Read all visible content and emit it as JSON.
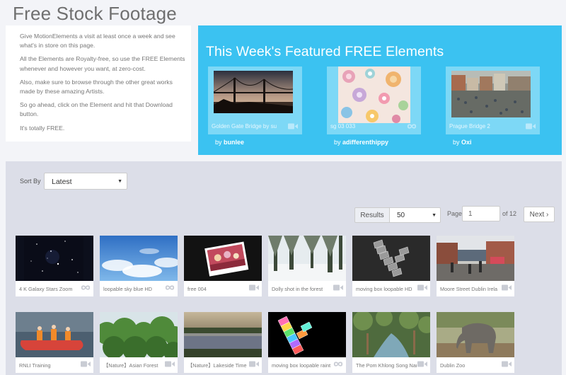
{
  "page_title": "Free Stock Footage",
  "intro": {
    "paragraphs": [
      "Give MotionElements a visit at least once a week and see what's in store on this page.",
      "All the Elements are Royalty-free, so use the FREE Elements whenever and however you want, at zero-cost.",
      "Also, make sure to browse through the other great works made by these amazing Artists.",
      "So go ahead, click on the Element and hit that Download button.",
      "It's totally FREE."
    ]
  },
  "featured": {
    "heading": "This Week's Featured FREE Elements",
    "items": [
      {
        "caption": "Golden Gate Bridge by su",
        "by": "by",
        "author": "bunlee",
        "icon": "video-camera-icon"
      },
      {
        "caption": "sg 03 033",
        "by": "by",
        "author": "adifferenthippy",
        "icon": "infinity-loop-icon"
      },
      {
        "caption": "Prague Bridge 2",
        "by": "by",
        "author": "Oxi",
        "icon": "video-camera-icon"
      }
    ]
  },
  "sort": {
    "label": "Sort By",
    "value": "Latest"
  },
  "pagination": {
    "results_label": "Results",
    "results_value": "50",
    "page_label": "Page",
    "page_value": "1",
    "of_text": "of 12",
    "next_label": "Next ›"
  },
  "grid": [
    {
      "caption": "4 K Galaxy Stars Zoom",
      "icon": "infinity-loop-icon"
    },
    {
      "caption": "loopable sky blue HD",
      "icon": "infinity-loop-icon"
    },
    {
      "caption": "free 004",
      "icon": "video-camera-icon"
    },
    {
      "caption": "Dolly shot in the forest",
      "icon": "video-camera-icon"
    },
    {
      "caption": "moving box loopable HD",
      "icon": "video-camera-icon"
    },
    {
      "caption": "Moore Street Dublin Irela",
      "icon": "video-camera-icon"
    },
    {
      "caption": "RNLI Training",
      "icon": "video-camera-icon"
    },
    {
      "caption": "【Nature】Asian Forest",
      "icon": "video-camera-icon"
    },
    {
      "caption": "【Nature】Lakeside Time",
      "icon": "video-camera-icon"
    },
    {
      "caption": "moving box loopable raint",
      "icon": "infinity-loop-icon"
    },
    {
      "caption": "The Pom Khlong Song Nar",
      "icon": "video-camera-icon"
    },
    {
      "caption": "Dublin Zoo",
      "icon": "video-camera-icon"
    }
  ],
  "colors": {
    "featured_bg": "#3bc2f1",
    "page_bg": "#f3f4f8",
    "browser_bg": "#dcdee8"
  }
}
